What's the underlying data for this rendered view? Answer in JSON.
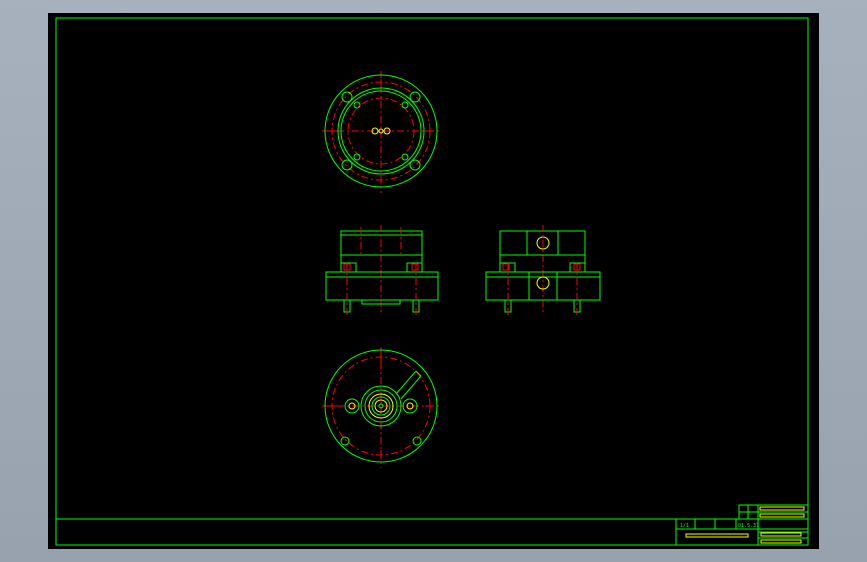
{
  "colors": {
    "background": "#000000",
    "outline": "#00ff00",
    "centerline": "#ff0000",
    "detail": "#ffff00",
    "frame_outer": "#9aa5b1"
  },
  "title_block": {
    "drawing_title": "",
    "drawing_number": "",
    "scale": "1/1",
    "sheet": "",
    "date": "01.5.31",
    "company": "",
    "rows": []
  }
}
